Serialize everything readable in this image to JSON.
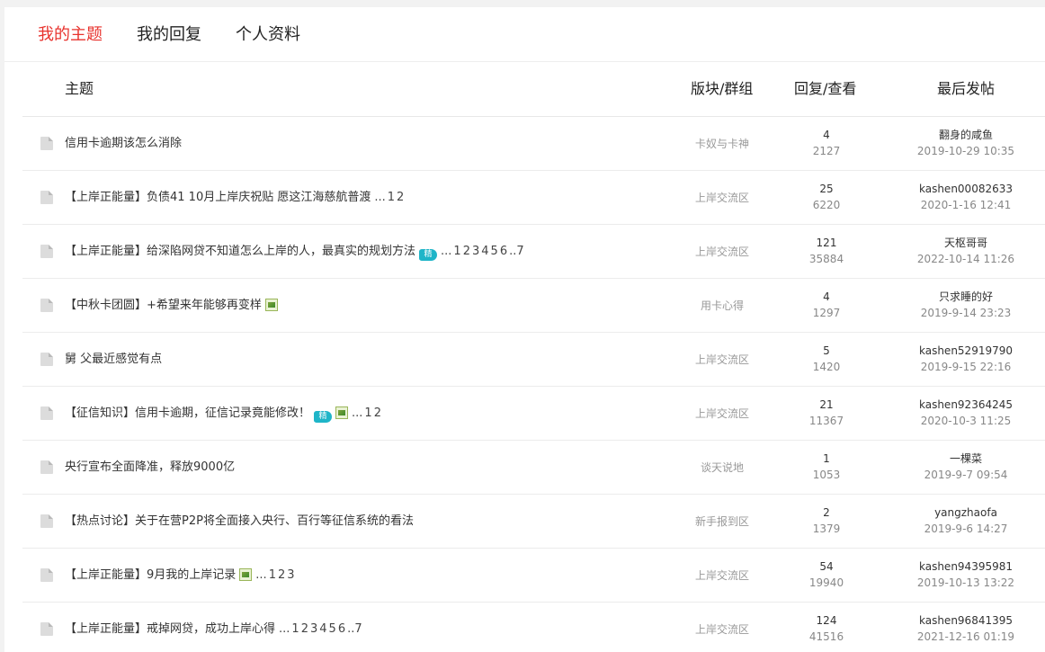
{
  "tabs": [
    {
      "label": "我的主题",
      "active": true
    },
    {
      "label": "我的回复",
      "active": false
    },
    {
      "label": "个人资料",
      "active": false
    }
  ],
  "headers": {
    "topic": "主题",
    "forum": "版块/群组",
    "stats": "回复/查看",
    "last": "最后发帖"
  },
  "badges": {
    "digest_label": "精"
  },
  "colors": {
    "accent": "#e8332e",
    "digest_badge": "#1fb5c8"
  },
  "threads": [
    {
      "title": "信用卡逾期该怎么消除",
      "digest": false,
      "image": false,
      "pages": [],
      "forum": "卡奴与卡神",
      "replies": "4",
      "views": "2127",
      "last_user": "翻身的咸鱼",
      "last_time": "2019-10-29 10:35"
    },
    {
      "title": "【上岸正能量】负债41 10月上岸庆祝贴 愿这江海慈航普渡",
      "digest": false,
      "image": false,
      "pages": [
        "1",
        "2"
      ],
      "forum": "上岸交流区",
      "replies": "25",
      "views": "6220",
      "last_user": "kashen00082633",
      "last_time": "2020-1-16 12:41"
    },
    {
      "title": "【上岸正能量】给深陷网贷不知道怎么上岸的人，最真实的规划方法",
      "digest": true,
      "image": false,
      "pages": [
        "1",
        "2",
        "3",
        "4",
        "5",
        "6",
        "..7"
      ],
      "forum": "上岸交流区",
      "replies": "121",
      "views": "35884",
      "last_user": "天枢哥哥",
      "last_time": "2022-10-14 11:26"
    },
    {
      "title": "【中秋卡团圆】+希望来年能够再变样",
      "digest": false,
      "image": true,
      "pages": [],
      "forum": "用卡心得",
      "replies": "4",
      "views": "1297",
      "last_user": "只求睡的好",
      "last_time": "2019-9-14 23:23"
    },
    {
      "title": "舅 父最近感觉有点",
      "digest": false,
      "image": false,
      "pages": [],
      "forum": "上岸交流区",
      "replies": "5",
      "views": "1420",
      "last_user": "kashen52919790",
      "last_time": "2019-9-15 22:16"
    },
    {
      "title": "【征信知识】信用卡逾期，征信记录竟能修改！",
      "digest": true,
      "image": true,
      "pages": [
        "1",
        "2"
      ],
      "forum": "上岸交流区",
      "replies": "21",
      "views": "11367",
      "last_user": "kashen92364245",
      "last_time": "2020-10-3 11:25"
    },
    {
      "title": "央行宣布全面降准，释放9000亿",
      "digest": false,
      "image": false,
      "pages": [],
      "forum": "谈天说地",
      "replies": "1",
      "views": "1053",
      "last_user": "一棵菜",
      "last_time": "2019-9-7 09:54"
    },
    {
      "title": "【热点讨论】关于在营P2P将全面接入央行、百行等征信系统的看法",
      "digest": false,
      "image": false,
      "pages": [],
      "forum": "新手报到区",
      "replies": "2",
      "views": "1379",
      "last_user": "yangzhaofa",
      "last_time": "2019-9-6 14:27"
    },
    {
      "title": "【上岸正能量】9月我的上岸记录",
      "digest": false,
      "image": true,
      "pages": [
        "1",
        "2",
        "3"
      ],
      "forum": "上岸交流区",
      "replies": "54",
      "views": "19940",
      "last_user": "kashen94395981",
      "last_time": "2019-10-13 13:22"
    },
    {
      "title": "【上岸正能量】戒掉网贷，成功上岸心得",
      "digest": false,
      "image": false,
      "pages": [
        "1",
        "2",
        "3",
        "4",
        "5",
        "6",
        "..7"
      ],
      "forum": "上岸交流区",
      "replies": "124",
      "views": "41516",
      "last_user": "kashen96841395",
      "last_time": "2021-12-16 01:19"
    }
  ]
}
